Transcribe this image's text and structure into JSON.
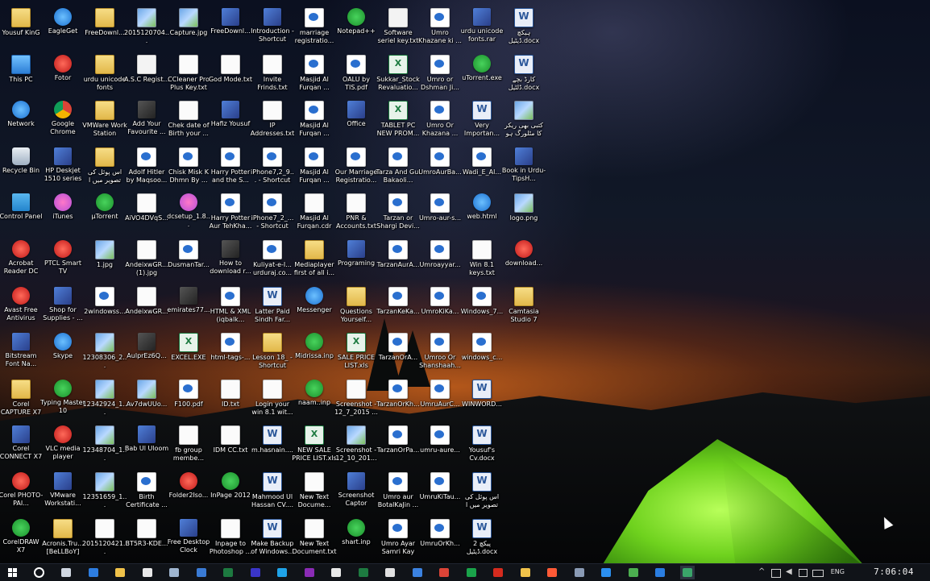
{
  "desktop": {
    "columns": [
      [
        "Yousuf KinG",
        "This PC",
        "Network",
        "Recycle Bin",
        "Control Panel",
        "Acrobat Reader DC",
        "Avast Free Antivirus",
        "Bitstream Font Na...",
        "Corel CAPTURE X7",
        "Corel CONNECT X7",
        "Corel PHOTO-PAI...",
        "CorelDRAW X7"
      ],
      [
        "EagleGet",
        "Fotor",
        "Google Chrome",
        "HP Deskjet 1510 series",
        "iTunes",
        "PTCL Smart TV",
        "Shop for Supplies - ...",
        "Skype",
        "Typing Master 10",
        "VLC media player",
        "VMware Workstati...",
        "Acronis.Tru... [BeLLBoY]"
      ],
      [
        "FreeDownl...",
        "urdu unicode fonts",
        "VMWare Work Station",
        "اس پوئل کی تصویر میں ا",
        "µTorrent",
        "1.jpg",
        "2windowss...",
        "12308306_2...",
        "12342924_1...",
        "12348704_1...",
        "12351659_1...",
        "2015120421..."
      ],
      [
        "2015120704...",
        "A.S.C Regist...",
        "Add Your Favourite ...",
        "Adolf Hitler by Maqsoo...",
        "AiVO4DVqS...",
        "AndeixwGR... (1).jpg",
        "AndeixwGR...",
        "AulprEz6Q...",
        "Av7dwUUo...",
        "Bab Ul Uloom",
        "Birth Certificate ...",
        "BT5R3-KDE..."
      ],
      [
        "Capture.jpg",
        "CCleaner Pro Plus Key.txt",
        "Chek date of Birth your ...",
        "Chisk Misk K Dhmn By ...",
        "dcsetup_1.8...",
        "DusmanTar...",
        "emirates77...",
        "EXCEL.EXE",
        "F100.pdf",
        "fb group membe...",
        "Folder2Iso...",
        "Free Desktop Clock"
      ],
      [
        "FreeDownl...",
        "God Mode.txt",
        "Hafiz Yousuf",
        "Harry Potter and the S...",
        "Harry Potter Aur TehKha...",
        "How to download r...",
        "HTML & XML (iqbalk...",
        "html-tags-...",
        "ID.txt",
        "IDM CC.txt",
        "InPage 2012",
        "Inpage to Photoshop ..."
      ],
      [
        "Introduction - Shortcut",
        "Invite Frinds.txt",
        "IP Addresses.txt",
        "iPhone7,2_9... - Shortcut",
        "iPhone7_2_... - Shortcut",
        "Kuliyat-e-I... urduraj.co...",
        "Latter Paid Sindh Far...",
        "Lesson 18_ - Shortcut",
        "Login your win 8.1 wit...",
        "m.hasnain....",
        "Mahmood Ul Hassan CV....",
        "Make Backup of Windows..."
      ],
      [
        "marriage registratio...",
        "Masjid Al Furqan ...",
        "Masjid Al Furqan ...",
        "Masjid Al Furqan ...",
        "Masjid Al Furqan.cdr",
        "Mediaplayer first of all i...",
        "Messenger",
        "Midrissa.inp",
        "naam..inp",
        "NEW SALE PRICE LIST.xls",
        "New Text Docume...",
        "New Text Document.txt"
      ],
      [
        "Notepad++",
        "OALU by TIS.pdf",
        "Office",
        "Our Marriage Registratio...",
        "PNR & Accounts.txt",
        "Programing",
        "Questions Yourself...",
        "SALE PRICE LIST.xls",
        "Screenshot - 12_7_2015 ...",
        "Screenshot - 12_10_201...",
        "Screenshot Captor",
        "shart.inp"
      ],
      [
        "Software seriel key.txt",
        "Sukkar_Stock Revaluatio...",
        "TABLET PC NEW PROM...",
        "Tarza And Gul Bakaoli...",
        "Tarzan or Shargi Devi...",
        "TarzanAurA...",
        "TarzanKeKa...",
        "TarzanOrA...",
        "TarzanOrKh...",
        "TarzanOrPa...",
        "Umro aur BotalKaJin ...",
        "Umro Ayar Samri Kay C..."
      ],
      [
        "Umro Khazane ki ...",
        "Umro or Dshman Ji...",
        "Umro Or Khazana ...",
        "UmroAurBa...",
        "Umro-aur-s...",
        "Umroayyar...",
        "UmroKiKa...",
        "Umroo Or Shanshaah...",
        "UmruAurC...",
        "umru-aure...",
        "UmruKiTau...",
        "UmruOrKh..."
      ],
      [
        "urdu unicode fonts.rar",
        "uTorrent.exe",
        "Very Importan...",
        "Wadi_E_Al...",
        "web.html",
        "Win 8.1 keys.txt",
        "Windows_7...",
        "windows_c...",
        "WINWORD...",
        "Yousuf's Cv.docx",
        "اس پوئل کی تصویر میں ا",
        "پیکچ 2 ڈیٹیل.docx"
      ],
      [
        "ہیکچ ڈیٹیل.docx",
        "کارڈ بچے ڈلٹیل.docx",
        "کتبی بھی ریکر کا مٹلورگ ہو",
        "Book in Urdu-TipsH...",
        "logo.png",
        "download...",
        "Camtasia Studio 7"
      ]
    ],
    "types": [
      [
        "folder",
        "pc",
        "blue",
        "bin",
        "control",
        "red",
        "red",
        "app",
        "folder",
        "app",
        "red",
        "green"
      ],
      [
        "blue",
        "red",
        "chrome",
        "app",
        "itunes",
        "red",
        "app",
        "blue",
        "green",
        "red",
        "app",
        "folder"
      ],
      [
        "folder",
        "folder",
        "folder",
        "folder",
        "green",
        "image",
        "pdf",
        "image",
        "image",
        "image",
        "image",
        "text"
      ],
      [
        "image",
        "doc",
        "dark",
        "pdf",
        "text",
        "text",
        "text",
        "dark",
        "image",
        "app",
        "pdf",
        "text"
      ],
      [
        "image",
        "text",
        "text",
        "pdf",
        "itunes",
        "pdf",
        "dark",
        "excel",
        "pdf",
        "text",
        "red",
        "app"
      ],
      [
        "app",
        "text",
        "app",
        "pdf",
        "pdf",
        "dark",
        "pdf",
        "pdf",
        "text",
        "text",
        "green",
        "text"
      ],
      [
        "app",
        "text",
        "text",
        "pdf",
        "pdf",
        "pdf",
        "word",
        "folder",
        "text",
        "word",
        "word",
        "word"
      ],
      [
        "pdf",
        "pdf",
        "pdf",
        "pdf",
        "text",
        "folder",
        "blue",
        "green",
        "green",
        "excel",
        "text",
        "text"
      ],
      [
        "green",
        "pdf",
        "app",
        "pdf",
        "text",
        "app",
        "folder",
        "excel",
        "text",
        "image",
        "app",
        "green"
      ],
      [
        "doc",
        "excel",
        "excel",
        "pdf",
        "pdf",
        "pdf",
        "pdf",
        "pdf",
        "pdf",
        "pdf",
        "pdf",
        "pdf"
      ],
      [
        "pdf",
        "pdf",
        "pdf",
        "pdf",
        "pdf",
        "pdf",
        "pdf",
        "pdf",
        "pdf",
        "pdf",
        "pdf",
        "pdf"
      ],
      [
        "app",
        "green",
        "word",
        "pdf",
        "blue",
        "text",
        "pdf",
        "pdf",
        "word",
        "word",
        "word",
        "word"
      ],
      [
        "word",
        "word",
        "image",
        "app",
        "image",
        "red",
        "folder"
      ]
    ]
  },
  "taskbar": {
    "start_icon": "windows-logo-icon",
    "search_icon": "cortana-circle-icon",
    "pinned": [
      {
        "name": "task-view",
        "color": "#cfd6e0"
      },
      {
        "name": "edge",
        "color": "#2d7de0"
      },
      {
        "name": "file-explorer",
        "color": "#f0c24a"
      },
      {
        "name": "store",
        "color": "#e8e8e8"
      },
      {
        "name": "app-arrow",
        "color": "#9fb6d0"
      },
      {
        "name": "app-blue",
        "color": "#3a7bd5"
      },
      {
        "name": "excel",
        "color": "#1d7a40"
      },
      {
        "name": "app-purple",
        "color": "#3a35c8"
      },
      {
        "name": "skype",
        "color": "#1fa3e8"
      },
      {
        "name": "onenote",
        "color": "#8a2bb5"
      },
      {
        "name": "mail",
        "color": "#e8e8e8"
      },
      {
        "name": "excel-2",
        "color": "#1d7a40"
      },
      {
        "name": "itunes",
        "color": "#e0e0e0"
      },
      {
        "name": "app-blue-2",
        "color": "#3b82e0"
      },
      {
        "name": "chrome",
        "color": "#db4437"
      },
      {
        "name": "app-green",
        "color": "#1aa34a"
      },
      {
        "name": "acrobat",
        "color": "#d52b1e"
      },
      {
        "name": "folder",
        "color": "#f0c24a"
      },
      {
        "name": "fotor",
        "color": "#ff5a36"
      },
      {
        "name": "app-grey",
        "color": "#8a9bb5"
      },
      {
        "name": "messenger",
        "color": "#2b8ff0"
      },
      {
        "name": "utorrent",
        "color": "#4caf50"
      },
      {
        "name": "photoshop",
        "color": "#2a7de0"
      },
      {
        "name": "app-active",
        "color": "#3aa56a"
      }
    ],
    "language": "ENG",
    "clock": "7:06:04"
  }
}
